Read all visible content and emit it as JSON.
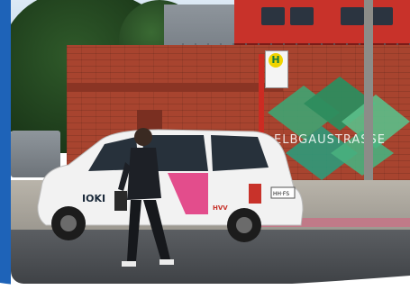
{
  "scene": {
    "station_sign_letter": "H",
    "wall_text": "ELBGAUSTRASSE",
    "taxi_brand": "IOKI",
    "taxi_side_logo": "HVV",
    "plate_text": "HH·FS"
  },
  "colors": {
    "accent_blue": "#1e63b8",
    "train_red": "#c8322a",
    "brick": "#a8442f",
    "graphic_green": "#3fa472",
    "taxi_pink": "#e0307a"
  }
}
